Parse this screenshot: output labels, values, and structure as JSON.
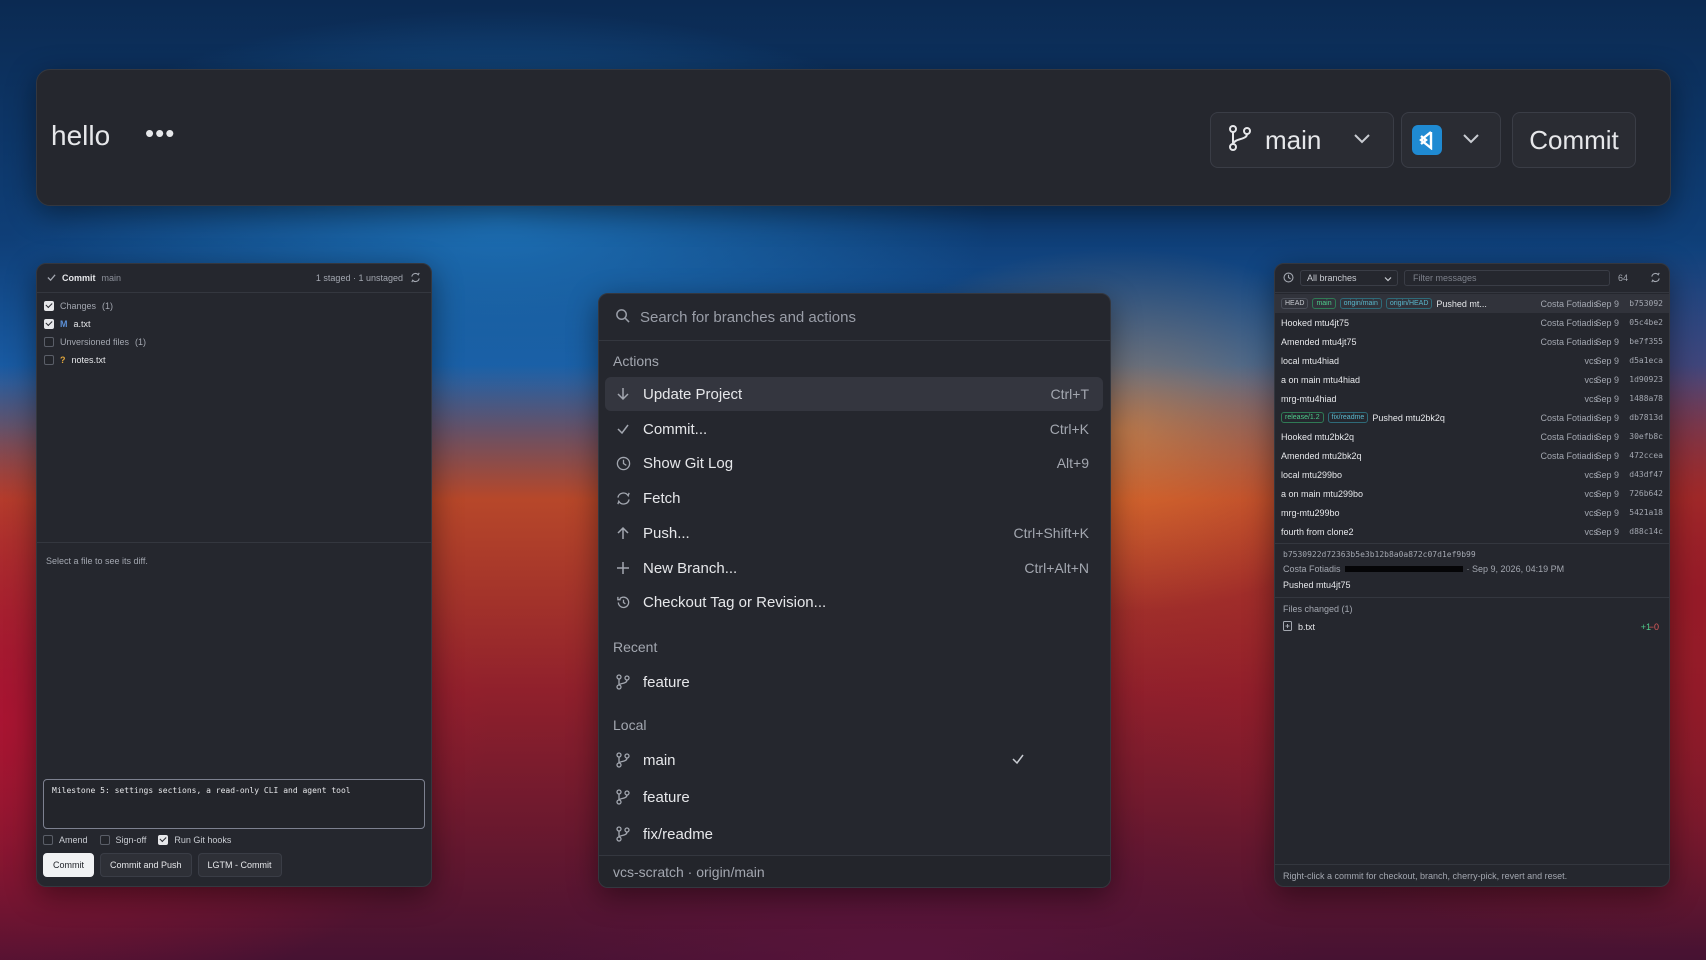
{
  "toolbar": {
    "title": "hello",
    "more_label": "•••",
    "branch": "main",
    "commit_label": "Commit"
  },
  "commit_panel": {
    "title": "Commit",
    "branch": "main",
    "counts": "1 staged · 1 unstaged",
    "tree": {
      "changes_label": "Changes",
      "changes_count": "(1)",
      "changed_file_status": "M",
      "changed_file": "a.txt",
      "unversioned_label": "Unversioned files",
      "unversioned_count": "(1)",
      "unversioned_file_status": "?",
      "unversioned_file": "notes.txt"
    },
    "diff_hint": "Select a file to see its diff.",
    "message": "Milestone 5: settings sections, a read-only CLI and agent tool",
    "options": {
      "amend": "Amend",
      "signoff": "Sign-off",
      "hooks": "Run Git hooks"
    },
    "buttons": {
      "commit": "Commit",
      "commit_push": "Commit and Push",
      "lgtm": "LGTM - Commit"
    }
  },
  "palette": {
    "search_placeholder": "Search for branches and actions",
    "actions_label": "Actions",
    "actions": [
      {
        "label": "Update Project",
        "shortcut": "Ctrl+T"
      },
      {
        "label": "Commit...",
        "shortcut": "Ctrl+K"
      },
      {
        "label": "Show Git Log",
        "shortcut": "Alt+9"
      },
      {
        "label": "Fetch",
        "shortcut": ""
      },
      {
        "label": "Push...",
        "shortcut": "Ctrl+Shift+K"
      },
      {
        "label": "New Branch...",
        "shortcut": "Ctrl+Alt+N"
      },
      {
        "label": "Checkout Tag or Revision...",
        "shortcut": ""
      }
    ],
    "recent_label": "Recent",
    "recent": [
      "feature"
    ],
    "local_label": "Local",
    "local": [
      "main",
      "feature",
      "fix/readme"
    ],
    "footer": "vcs-scratch · origin/main"
  },
  "log": {
    "branch_filter": "All branches",
    "filter_placeholder": "Filter messages",
    "count": "64",
    "commits": [
      {
        "tags": [
          "HEAD",
          "main",
          "origin/main",
          "origin/HEAD"
        ],
        "message": "Pushed mt...",
        "author": "Costa Fotiadis",
        "date": "Sep 9",
        "hash": "b753092"
      },
      {
        "tags": [],
        "message": "Hooked mtu4jt75",
        "author": "Costa Fotiadis",
        "date": "Sep 9",
        "hash": "05c4be2"
      },
      {
        "tags": [],
        "message": "Amended mtu4jt75",
        "author": "Costa Fotiadis",
        "date": "Sep 9",
        "hash": "be7f355"
      },
      {
        "tags": [],
        "message": "local mtu4hiad",
        "author": "vcs",
        "date": "Sep 9",
        "hash": "d5a1eca"
      },
      {
        "tags": [],
        "message": "a on main mtu4hiad",
        "author": "vcs",
        "date": "Sep 9",
        "hash": "1d90923"
      },
      {
        "tags": [],
        "message": "mrg-mtu4hiad",
        "author": "vcs",
        "date": "Sep 9",
        "hash": "1488a78"
      },
      {
        "tags": [
          "release/1.2",
          "fix/readme"
        ],
        "message": "Pushed mtu2bk2q",
        "author": "Costa Fotiadis",
        "date": "Sep 9",
        "hash": "db7813d"
      },
      {
        "tags": [],
        "message": "Hooked mtu2bk2q",
        "author": "Costa Fotiadis",
        "date": "Sep 9",
        "hash": "30efb8c"
      },
      {
        "tags": [],
        "message": "Amended mtu2bk2q",
        "author": "Costa Fotiadis",
        "date": "Sep 9",
        "hash": "472ccea"
      },
      {
        "tags": [],
        "message": "local mtu299bo",
        "author": "vcs",
        "date": "Sep 9",
        "hash": "d43df47"
      },
      {
        "tags": [],
        "message": "a on main mtu299bo",
        "author": "vcs",
        "date": "Sep 9",
        "hash": "726b642"
      },
      {
        "tags": [],
        "message": "mrg-mtu299bo",
        "author": "vcs",
        "date": "Sep 9",
        "hash": "5421a18"
      },
      {
        "tags": [],
        "message": "fourth from clone2",
        "author": "vcs",
        "date": "Sep 9",
        "hash": "d88c14c"
      }
    ],
    "detail": {
      "full_hash": "b7530922d72363b5e3b12b8a0a872c07d1ef9b99",
      "author": "Costa Fotiadis",
      "date": "· Sep 9, 2026, 04:19 PM",
      "subject": "Pushed mtu4jt75"
    },
    "files_label": "Files changed (1)",
    "files": [
      {
        "name": "b.txt",
        "added": "+1",
        "removed": "−0"
      }
    ],
    "footer": "Right-click a commit for checkout, branch, cherry-pick, revert and reset."
  },
  "colors": {
    "panel_bg": "#25272e",
    "accent_green": "#4fcb8b",
    "accent_red": "#e05c5c",
    "vscode_blue": "#1f8ad2"
  }
}
